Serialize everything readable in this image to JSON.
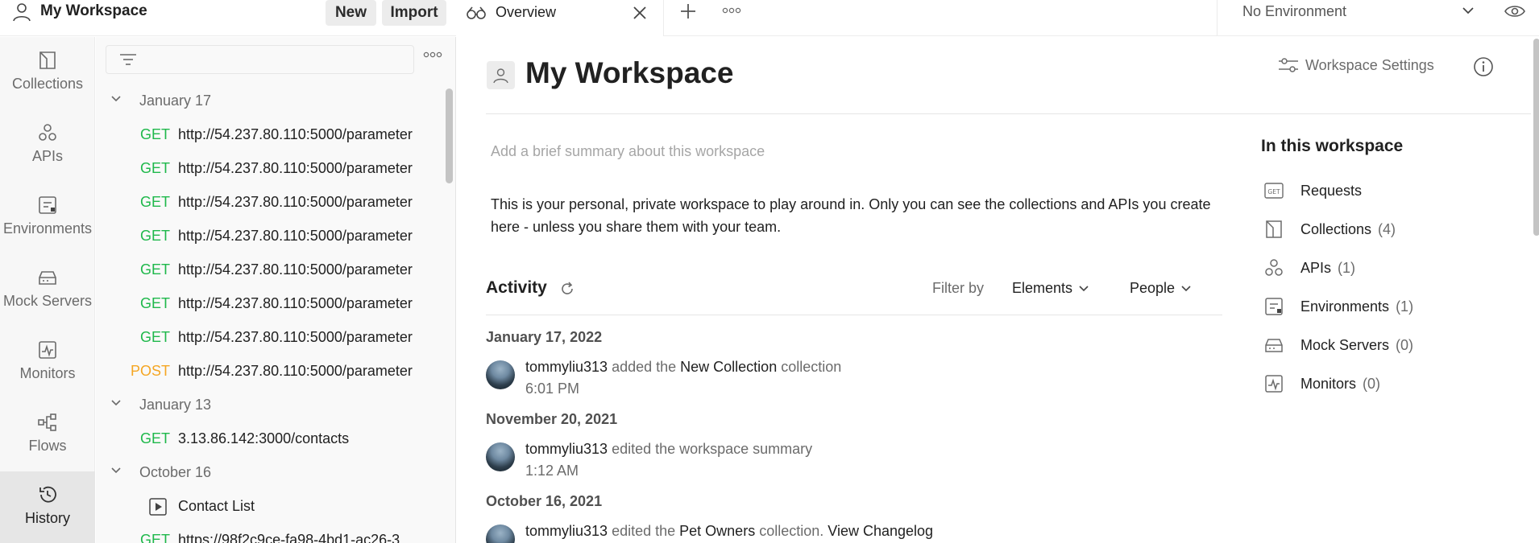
{
  "workspace_header": {
    "name": "My Workspace",
    "new_label": "New",
    "import_label": "Import"
  },
  "rail": [
    {
      "label": "Collections",
      "icon": "collections-icon"
    },
    {
      "label": "APIs",
      "icon": "apis-icon"
    },
    {
      "label": "Environments",
      "icon": "environments-icon"
    },
    {
      "label": "Mock Servers",
      "icon": "mock-servers-icon"
    },
    {
      "label": "Monitors",
      "icon": "monitors-icon"
    },
    {
      "label": "Flows",
      "icon": "flows-icon"
    },
    {
      "label": "History",
      "icon": "history-icon",
      "active": true
    }
  ],
  "history": {
    "groups": [
      {
        "label": "January 17"
      },
      {
        "label": "January 13"
      },
      {
        "label": "October 16"
      }
    ],
    "requests": [
      {
        "method": "GET",
        "url": "http://54.237.80.110:5000/parameter"
      },
      {
        "method": "GET",
        "url": "http://54.237.80.110:5000/parameter"
      },
      {
        "method": "GET",
        "url": "http://54.237.80.110:5000/parameter"
      },
      {
        "method": "GET",
        "url": "http://54.237.80.110:5000/parameter"
      },
      {
        "method": "GET",
        "url": "http://54.237.80.110:5000/parameter"
      },
      {
        "method": "GET",
        "url": "http://54.237.80.110:5000/parameter"
      },
      {
        "method": "GET",
        "url": "http://54.237.80.110:5000/parameter"
      },
      {
        "method": "POST",
        "url": "http://54.237.80.110:5000/parameter"
      },
      {
        "method": "GET",
        "url": "3.13.86.142:3000/contacts"
      },
      {
        "method": "",
        "url": "Contact List"
      },
      {
        "method": "GET",
        "url": "https://98f2c9ce-fa98-4bd1-ac26-3"
      }
    ]
  },
  "tabs": {
    "overview_label": "Overview"
  },
  "environment": {
    "selected": "No Environment"
  },
  "overview": {
    "title": "My Workspace",
    "settings_label": "Workspace Settings",
    "summary_placeholder": "Add a brief summary about this workspace",
    "description": "This is your personal, private workspace to play around in. Only you can see the collections and APIs you create here - unless you share them with your team."
  },
  "activity": {
    "title": "Activity",
    "filter_by": "Filter by",
    "elements_label": "Elements",
    "people_label": "People",
    "entries": [
      {
        "date": "January 17, 2022",
        "user": "tommyliu313",
        "action": "added the",
        "target": "New Collection",
        "suffix": "collection",
        "time": "6:01 PM"
      },
      {
        "date": "November 20, 2021",
        "user": "tommyliu313",
        "action": "edited the workspace summary",
        "target": "",
        "suffix": "",
        "time": "1:12 AM"
      },
      {
        "date": "October 16, 2021",
        "user": "tommyliu313",
        "action": "edited the",
        "target": "Pet Owners",
        "suffix": "collection.",
        "link": "View Changelog",
        "time": ""
      }
    ]
  },
  "in_workspace": {
    "title": "In this workspace",
    "items": [
      {
        "label": "Requests",
        "count": ""
      },
      {
        "label": "Collections",
        "count": "(4)"
      },
      {
        "label": "APIs",
        "count": "(1)"
      },
      {
        "label": "Environments",
        "count": "(1)"
      },
      {
        "label": "Mock Servers",
        "count": "(0)"
      },
      {
        "label": "Monitors",
        "count": "(0)"
      }
    ]
  },
  "colors": {
    "get": "#1fb84b",
    "post": "#f5a623",
    "text": "#212121",
    "muted": "#6b6b6b"
  }
}
